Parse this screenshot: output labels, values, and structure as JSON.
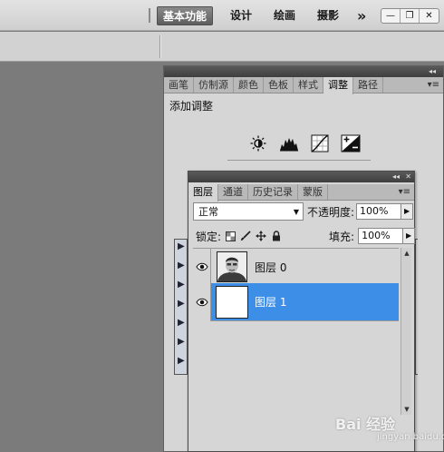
{
  "workspace": {
    "items": [
      "基本功能",
      "设计",
      "绘画",
      "摄影"
    ],
    "more": "»",
    "window_buttons": [
      "—",
      "❐",
      "✕"
    ]
  },
  "adjust_panel": {
    "tabs": [
      "画笔",
      "仿制源",
      "颜色",
      "色板",
      "样式",
      "调整",
      "路径"
    ],
    "active_tab": "调整",
    "collapse": "◂◂",
    "close": "✕",
    "menu": "▾≡",
    "title": "添加调整",
    "icons": [
      "brightness-icon",
      "levels-icon",
      "curves-icon",
      "exposure-icon"
    ]
  },
  "layers_panel": {
    "tabs": [
      "图层",
      "通道",
      "历史记录",
      "蒙版"
    ],
    "active_tab": "图层",
    "collapse": "◂◂",
    "close": "✕",
    "menu": "▾≡",
    "blend_mode": "正常",
    "opacity_label": "不透明度:",
    "opacity_value": "100%",
    "lock_label": "锁定:",
    "fill_label": "填充:",
    "fill_value": "100%",
    "layers": [
      {
        "name": "图层 0",
        "selected": false
      },
      {
        "name": "图层 1",
        "selected": true
      }
    ],
    "selection_color": "#3d8ee6"
  },
  "watermark": {
    "text": "Bai 经验",
    "sub": "jingyan.baidu.com"
  }
}
